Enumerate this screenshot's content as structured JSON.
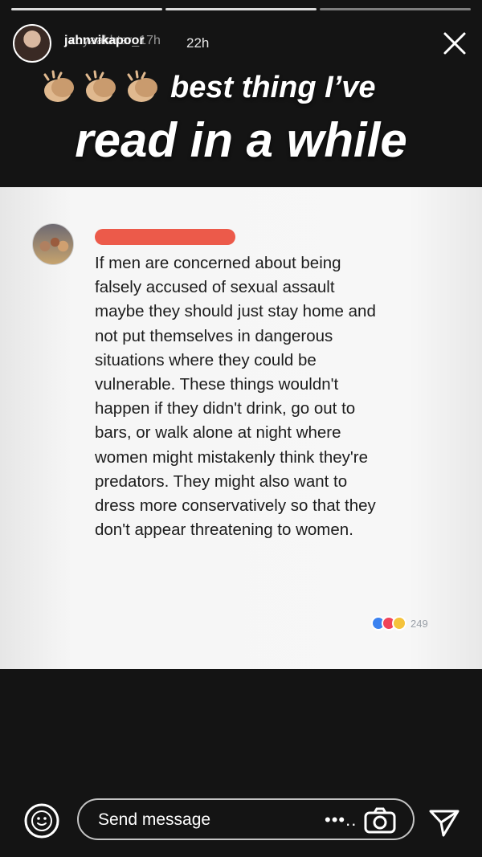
{
  "story": {
    "progress_segments": 3,
    "progress_done": 2
  },
  "header": {
    "username_top": "jahnvikapoor",
    "username_under": "zoyaakhtar_17h",
    "time_ago": "22h",
    "close_icon": "close-icon"
  },
  "caption": {
    "emoji": "clapping-hands-icon",
    "emoji_count": 3,
    "line1": "best thing I’ve",
    "line2": "read in a while"
  },
  "post": {
    "avatar_icon": "group-photo-avatar",
    "author_redacted": true,
    "body": "If men are concerned about being falsely accused of sexual assault maybe they should just stay home and not put themselves in dangerous situations where they could be vulnerable. These things wouldn't happen if they didn't drink, go out to bars, or walk alone at night where women might mistakenly think they're predators. They might also want to dress more conservatively so that they don't appear threatening to women.",
    "reactions": [
      "like-icon",
      "love-icon",
      "haha-icon"
    ],
    "reaction_count": "249",
    "colors": {
      "redaction": "#ec5a4a",
      "like": "#3b82f0",
      "love": "#f0445a",
      "haha": "#f5c33b"
    }
  },
  "footer": {
    "message_placeholder": "Send message",
    "more_dots": "•••..",
    "emoji_icon": "smiley-icon",
    "camera_icon": "camera-icon",
    "send_icon": "send-icon"
  }
}
